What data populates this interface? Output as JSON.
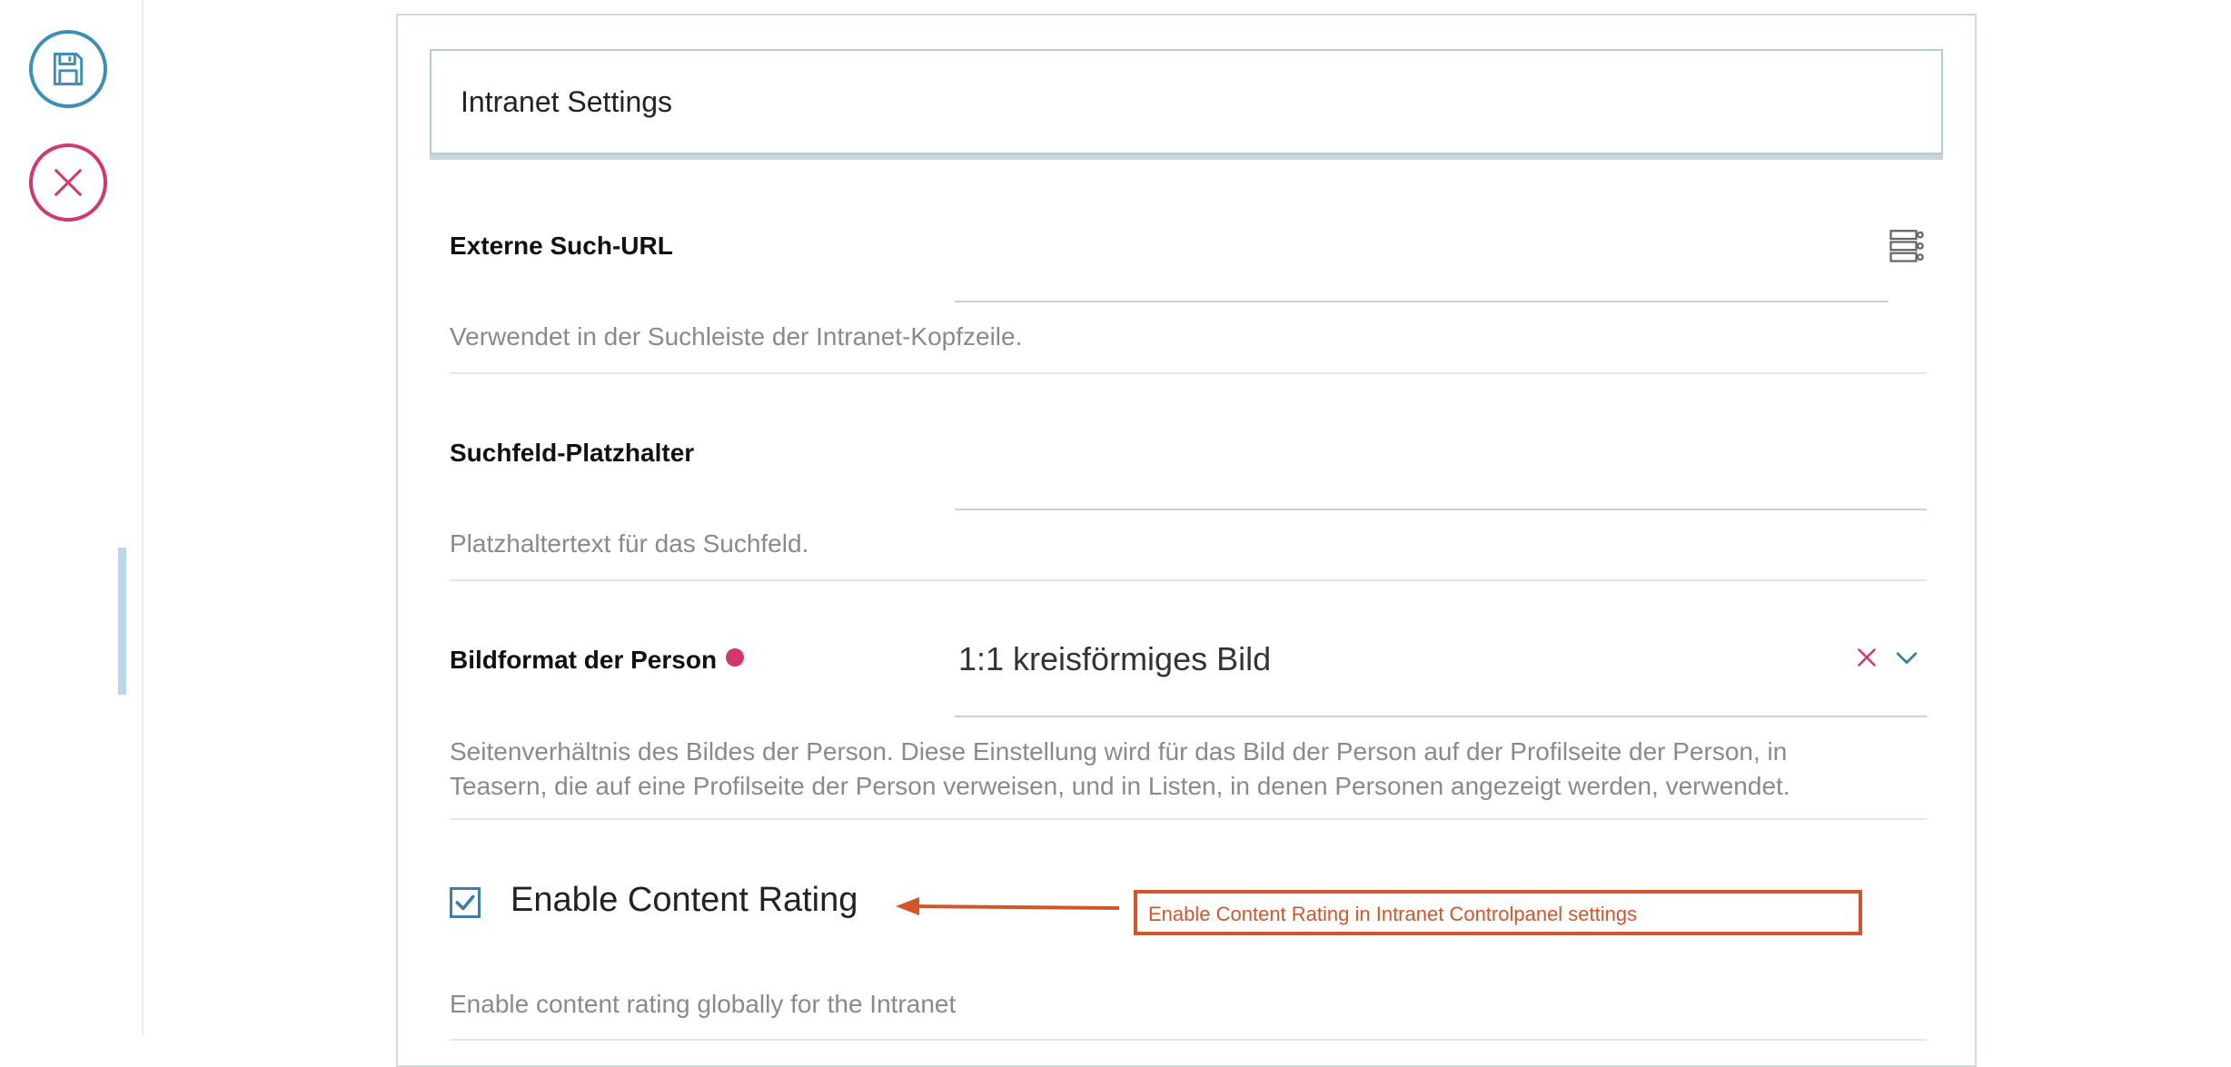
{
  "toolbar": {
    "save_icon": "floppy-disk-icon",
    "cancel_icon": "close-x-icon",
    "save_color": "#3d8fb5",
    "cancel_color": "#d2386f"
  },
  "form": {
    "title": "Intranet Settings",
    "fields": [
      {
        "label": "Externe Such-URL",
        "value": "",
        "help": "Verwendet in der Suchleiste der Intranet-Kopfzeile.",
        "icon": "server-list-icon"
      },
      {
        "label": "Suchfeld-Platzhalter",
        "value": "",
        "help": "Platzhaltertext für das Suchfeld."
      },
      {
        "label": "Bildformat der Person",
        "required": true,
        "value": "1:1 kreisförmiges Bild",
        "help_line1": "Seitenverhältnis des Bildes der Person. Diese Einstellung wird für das Bild der Person auf der Profilseite der Person, in",
        "help_line2": "Teasern, die auf eine Profilseite der Person verweisen, und in Listen, in denen Personen angezeigt werden, verwendet."
      },
      {
        "label": "Enable Content Rating",
        "checked": true,
        "help": "Enable content rating globally for the Intranet"
      }
    ]
  },
  "annotation": {
    "text": "Enable Content Rating in Intranet Controlpanel settings",
    "color": "#d2562c"
  }
}
